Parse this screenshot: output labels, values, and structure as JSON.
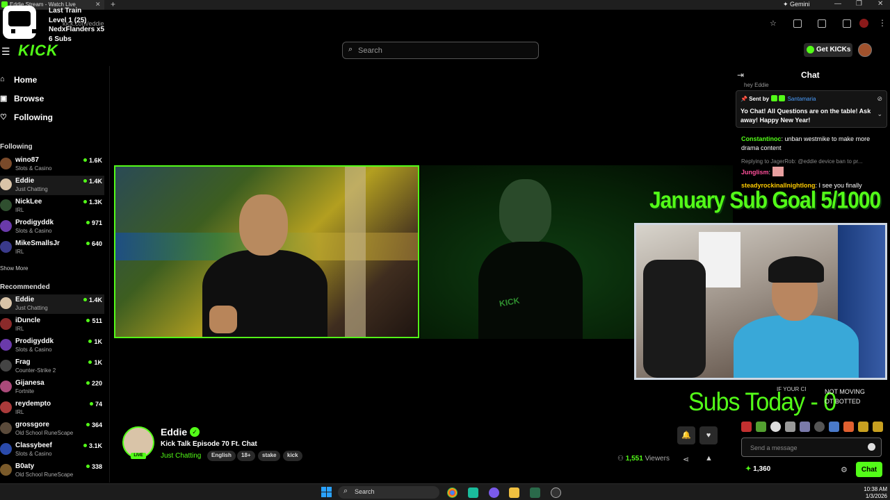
{
  "browser": {
    "tab_title": "Eddie Stream - Watch Live",
    "gemini_label": "Gemini",
    "url": "kick.com/eddie"
  },
  "overlay": {
    "line1": "Last Train",
    "line2": "Level 1 (25)",
    "line3": "NedxFlanders x5",
    "line4": "6 Subs"
  },
  "header": {
    "logo": "KICK",
    "search_placeholder": "Search",
    "get_kicks_label": "Get KICKs"
  },
  "sidebar": {
    "nav": [
      {
        "label": "Home",
        "icon": "home-icon"
      },
      {
        "label": "Browse",
        "icon": "browse-icon"
      },
      {
        "label": "Following",
        "icon": "heart-icon"
      }
    ],
    "following_title": "Following",
    "following": [
      {
        "name": "wino87",
        "category": "Slots & Casino",
        "viewers": "1.6K",
        "color": "#7a4a2a"
      },
      {
        "name": "Eddie",
        "category": "Just Chatting",
        "viewers": "1.4K",
        "color": "#d9c4a8",
        "active": true
      },
      {
        "name": "NickLee",
        "category": "IRL",
        "viewers": "1.3K",
        "color": "#2f4f2f"
      },
      {
        "name": "Prodigyddk",
        "category": "Slots & Casino",
        "viewers": "971",
        "color": "#6a3aaa"
      },
      {
        "name": "MikeSmallsJr",
        "category": "IRL",
        "viewers": "640",
        "color": "#3a3a8a"
      }
    ],
    "show_more": "Show More",
    "recommended_title": "Recommended",
    "recommended": [
      {
        "name": "Eddie",
        "category": "Just Chatting",
        "viewers": "1.4K",
        "color": "#d9c4a8",
        "active": true
      },
      {
        "name": "iDuncle",
        "category": "IRL",
        "viewers": "511",
        "color": "#8a2a2a"
      },
      {
        "name": "Prodigyddk",
        "category": "Slots & Casino",
        "viewers": "1K",
        "color": "#6a3aaa"
      },
      {
        "name": "Frag",
        "category": "Counter-Strike 2",
        "viewers": "1K",
        "color": "#444"
      },
      {
        "name": "Gijanesa",
        "category": "Fortnite",
        "viewers": "220",
        "color": "#aa4a7a"
      },
      {
        "name": "reydempto",
        "category": "IRL",
        "viewers": "74",
        "color": "#aa3a3a"
      },
      {
        "name": "grossgore",
        "category": "Old School RuneScape",
        "viewers": "364",
        "color": "#5a4a3a"
      },
      {
        "name": "Classybeef",
        "category": "Slots & Casino",
        "viewers": "3.1K",
        "color": "#2a4aaa"
      },
      {
        "name": "B0aty",
        "category": "Old School RuneScape",
        "viewers": "338",
        "color": "#7a5a2a"
      }
    ]
  },
  "stream": {
    "goal_text": "January Sub Goal 5/1000",
    "subs_today": "Subs Today - 0",
    "not_moving": "NOT MOVING",
    "ot_botted": "OT BOTTED",
    "scroller": "IF YOUR CI"
  },
  "channel": {
    "name": "Eddie",
    "live_badge": "LIVE",
    "title": "Kick Talk Episode 70 Ft. Chat",
    "category": "Just Chatting",
    "tags": [
      "English",
      "18+",
      "stake",
      "kick"
    ],
    "viewers_count": "1,551",
    "viewers_label": "Viewers"
  },
  "chat": {
    "title": "Chat",
    "partial_top": "hey Eddie",
    "pinned": {
      "sent_by_label": "Sent by",
      "sender": "Santamaria",
      "message": "Yo Chat! All Questions are on the table! Ask away! Happy New Year!"
    },
    "messages": [
      {
        "user": "Constantinoc",
        "color": "#53fc18",
        "text": "unban westmike to make more drama content"
      },
      {
        "reply": "Replying to JagerRob: @eddie device ban to pr..."
      },
      {
        "user": "Junglism",
        "color": "#ff4f9a",
        "text": ""
      },
      {
        "user": "steadyrockinallnightlong",
        "color": "#ffcc00",
        "text": "I see you finally"
      }
    ],
    "input_placeholder": "Send a message",
    "kicks_count": "1,360",
    "send_label": "Chat"
  },
  "taskbar": {
    "search_label": "Search",
    "time": "10:38 AM",
    "date": "1/3/2026"
  }
}
